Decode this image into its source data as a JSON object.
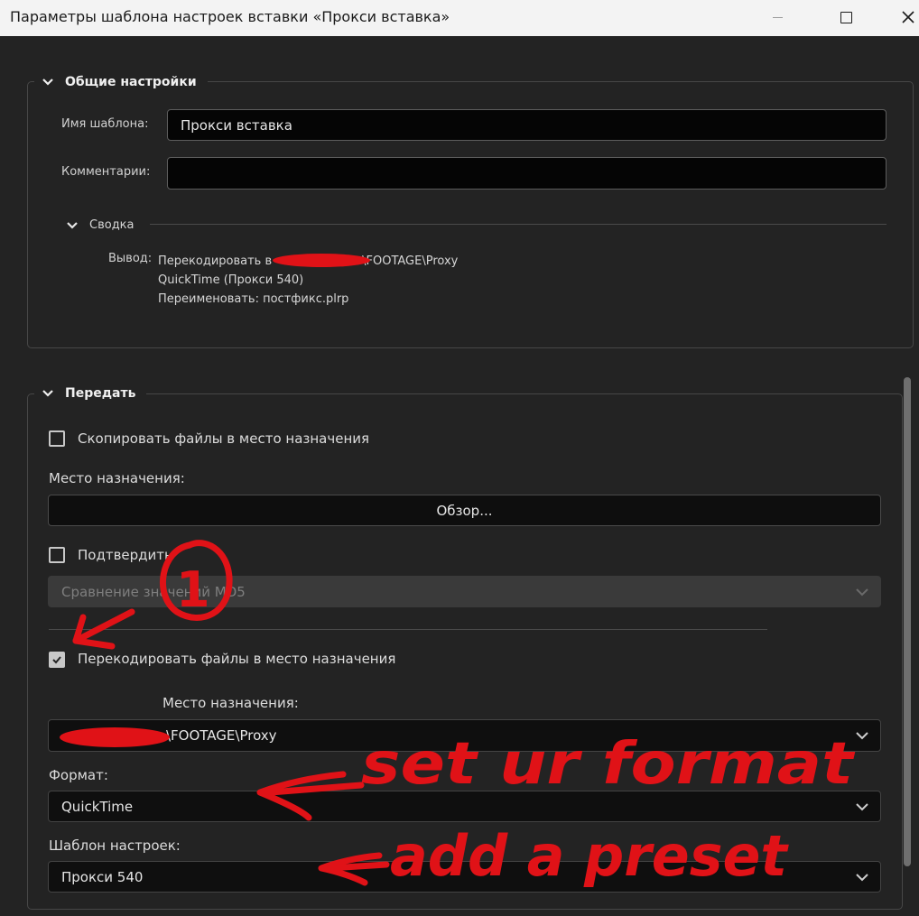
{
  "window": {
    "title": "Параметры шаблона настроек вставки «Прокси вставка»"
  },
  "general": {
    "header": "Общие настройки",
    "template_name_label": "Имя шаблона:",
    "template_name_value": "Прокси вставка",
    "comments_label": "Комментарии:",
    "comments_value": "",
    "summary": {
      "header": "Сводка",
      "output_label": "Вывод:",
      "line1_prefix": "Перекодировать в",
      "line1_suffix": "\\FOOTAGE\\Proxy",
      "line2": "QuickTime (Прокси 540)",
      "line3": "Переименовать: постфикс.plrp"
    }
  },
  "transfer": {
    "header": "Передать",
    "copy_label": "Скопировать файлы в место назначения",
    "copy_checked": false,
    "destination_label": "Место назначения:",
    "browse_label": "Обзор...",
    "verify_label": "Подтвердить",
    "verify_checked": false,
    "verify_method": "Сравнение значений MD5",
    "transcode_label": "Перекодировать файлы в место назначения",
    "transcode_checked": true,
    "transcode_destination_label": "Место назначения:",
    "transcode_destination_value": "\\FOOTAGE\\Proxy",
    "format_label": "Формат:",
    "format_value": "QuickTime",
    "preset_label": "Шаблон настроек:",
    "preset_value": "Прокси 540"
  },
  "annotations": {
    "circle_number": "1",
    "note_format": "set ur format",
    "note_preset": "add a preset",
    "color": "#e01217"
  }
}
